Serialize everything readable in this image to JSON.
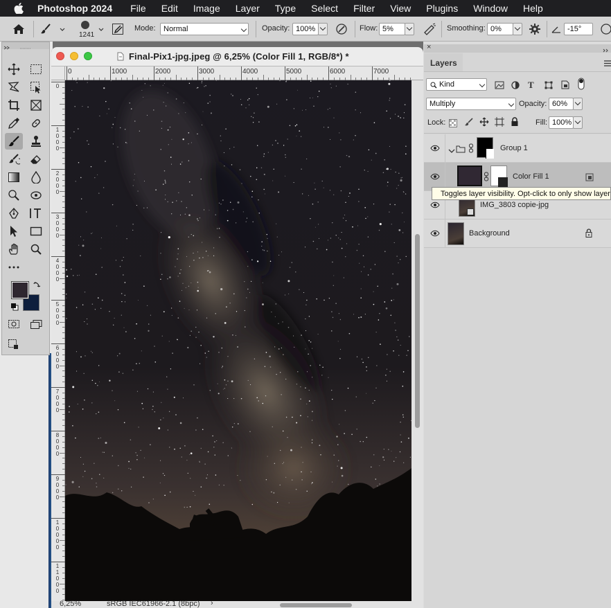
{
  "menubar": {
    "app_name": "Photoshop 2024",
    "items": [
      "File",
      "Edit",
      "Image",
      "Layer",
      "Type",
      "Select",
      "Filter",
      "View",
      "Plugins",
      "Window",
      "Help"
    ]
  },
  "options_bar": {
    "brush_size": "1241",
    "mode_label": "Mode:",
    "mode_value": "Normal",
    "opacity_label": "Opacity:",
    "opacity_value": "100%",
    "flow_label": "Flow:",
    "flow_value": "5%",
    "smoothing_label": "Smoothing:",
    "smoothing_value": "0%",
    "angle_value": "-15°"
  },
  "document": {
    "title": "Final-Pix1-jpg.jpeg @ 6,25% (Color Fill 1, RGB/8*) *",
    "ruler_h_labels": [
      "0",
      "1000",
      "2000",
      "3000",
      "4000",
      "5000",
      "6000",
      "7000"
    ],
    "ruler_v_labels": [
      "0",
      "1000",
      "2000",
      "3000",
      "4000",
      "5000",
      "6000",
      "7000",
      "8000",
      "9000",
      "10000",
      "11000"
    ],
    "zoom": "6,25%",
    "profile": "sRGB IEC61966-2.1 (8bpc)"
  },
  "tools": {
    "foreground_color": "#2f2730",
    "background_color": "#0e1f3d"
  },
  "layers_panel": {
    "tab_label": "Layers",
    "filter_kind": "Kind",
    "blend_mode": "Multiply",
    "opacity_label": "Opacity:",
    "opacity_value": "60%",
    "lock_label": "Lock:",
    "fill_label": "Fill:",
    "fill_value": "100%",
    "layers": [
      {
        "name": "Group 1"
      },
      {
        "name": "Color Fill 1"
      },
      {
        "name": "IMG_3803 copie-jpg"
      },
      {
        "name": "Background"
      }
    ],
    "tooltip": "Toggles layer visibility. Opt-click to only show layer."
  }
}
